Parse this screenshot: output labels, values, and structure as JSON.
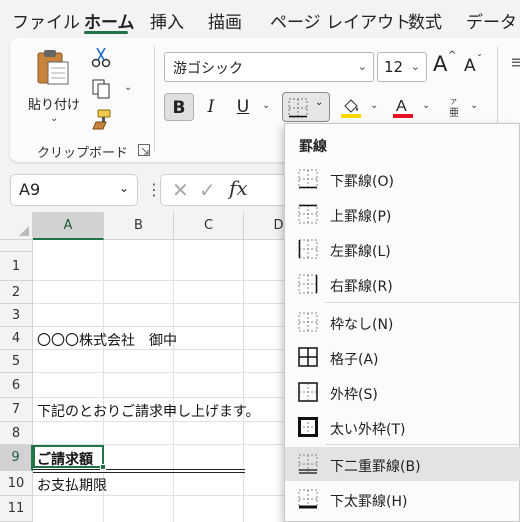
{
  "menu_tabs": [
    "ファイル",
    "ホーム",
    "挿入",
    "描画",
    "ページ レイアウト",
    "数式",
    "データ"
  ],
  "active_tab": "ホーム",
  "clipboard": {
    "paste_label": "貼り付け",
    "group_label": "クリップボード"
  },
  "font": {
    "name": "游ゴシック",
    "size": "12",
    "grow_label": "A",
    "shrink_label": "A",
    "bold": "B",
    "italic": "I",
    "underline": "U",
    "font_color": "#e81123",
    "fill_color": "#ffd800"
  },
  "formula_bar": {
    "name_box": "A9",
    "cancel": "✕",
    "enter": "✓",
    "fx": "fx"
  },
  "columns": [
    "A",
    "B",
    "C",
    "D"
  ],
  "rows": [
    "1",
    "2",
    "3",
    "4",
    "5",
    "6",
    "7",
    "8",
    "9",
    "10",
    "11"
  ],
  "cells": {
    "A4": "〇〇〇株式会社　御中",
    "A7": "下記のとおりご請求申し上げます。",
    "A9": "ご請求額",
    "A10": "お支払期限"
  },
  "border_menu": {
    "title": "罫線",
    "items": [
      {
        "label": "下罫線(O)",
        "icon": "border-bottom-icon"
      },
      {
        "label": "上罫線(P)",
        "icon": "border-top-icon"
      },
      {
        "label": "左罫線(L)",
        "icon": "border-left-icon"
      },
      {
        "label": "右罫線(R)",
        "icon": "border-right-icon"
      },
      {
        "label": "枠なし(N)",
        "icon": "no-border-icon"
      },
      {
        "label": "格子(A)",
        "icon": "all-borders-icon"
      },
      {
        "label": "外枠(S)",
        "icon": "outside-borders-icon"
      },
      {
        "label": "太い外枠(T)",
        "icon": "thick-outside-borders-icon"
      },
      {
        "label": "下二重罫線(B)",
        "icon": "bottom-double-border-icon"
      },
      {
        "label": "下太罫線(H)",
        "icon": "thick-bottom-border-icon"
      }
    ],
    "hovered": "下二重罫線(B)"
  },
  "colors": {
    "accent": "#217346",
    "selection_header": "#d2d2d2"
  }
}
